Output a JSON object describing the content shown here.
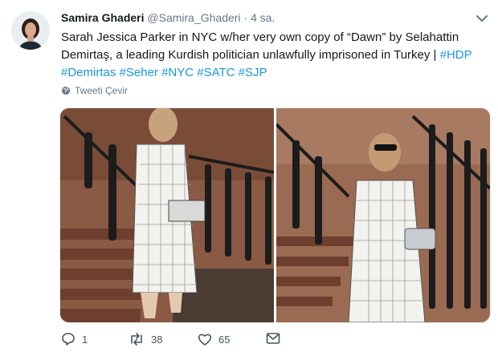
{
  "tweet": {
    "author_name": "Samira Ghaderi",
    "author_handle": "@Samira_Ghaderi",
    "separator": "·",
    "time": "4 sa.",
    "text_plain": "Sarah Jessica Parker in NYC w/her very own copy of “Dawn” by Selahattin Demirtaş, a leading Kurdish politician unlawfully imprisoned in Turkey |",
    "hashtags": [
      "#HDP",
      "#Demirtas",
      "#Seher",
      "#NYC",
      "#SATC",
      "#SJP"
    ],
    "translate_label": "Tweeti Çevir",
    "translate_icon": "globe-icon",
    "menu_icon": "chevron-down-icon"
  },
  "actions": {
    "reply_count": "1",
    "retweet_count": "38",
    "like_count": "65",
    "reply_icon": "reply-icon",
    "retweet_icon": "retweet-icon",
    "like_icon": "heart-icon",
    "dm_icon": "envelope-icon"
  },
  "colors": {
    "link": "#1b95e0",
    "muted": "#657786",
    "text": "#14171a"
  }
}
